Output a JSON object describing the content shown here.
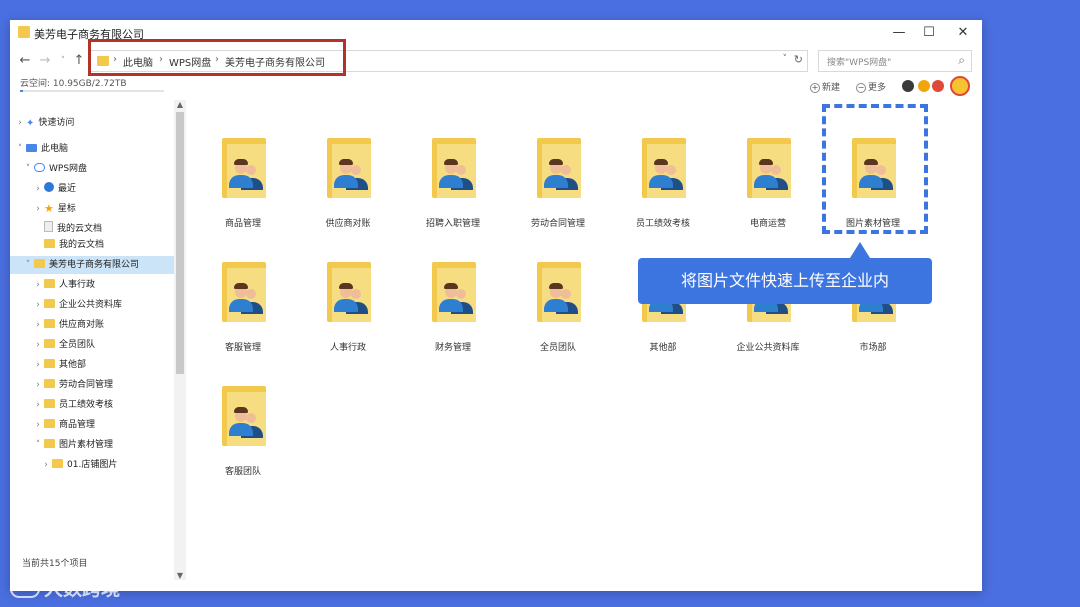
{
  "window": {
    "title": "美芳电子商务有限公司",
    "controls": {
      "minimize": "—",
      "maximize": "☐",
      "close": "✕"
    }
  },
  "nav": {
    "back": "←",
    "forward": "→",
    "dropdown": "˅",
    "up": "↑"
  },
  "address": {
    "leading_sep": "›",
    "crumbs": [
      "此电脑",
      "WPS网盘",
      "美芳电子商务有限公司"
    ],
    "sep": "›",
    "dropdown": "˅",
    "refresh": "↻"
  },
  "search": {
    "placeholder": "搜索\"WPS网盘\"",
    "icon": "⌕"
  },
  "storage": {
    "text": "云空间: 10.95GB/2.72TB",
    "used_fraction": 0.004
  },
  "toolbar": {
    "new_label": "新建",
    "more_label": "更多",
    "badge_colors": [
      "#3a3a3a",
      "#f2a60c",
      "#e0483a"
    ]
  },
  "sidebar": {
    "items": [
      {
        "label": "快速访问",
        "chev": "›",
        "icon": "pin"
      },
      {
        "label": "此电脑",
        "chev": "˅",
        "icon": "pc"
      },
      {
        "label": "WPS网盘",
        "chev": "˅",
        "icon": "cloud"
      },
      {
        "label": "最近",
        "chev": "›",
        "icon": "clock"
      },
      {
        "label": "星标",
        "chev": "›",
        "icon": "star"
      },
      {
        "label": "我的云文档",
        "chev": "",
        "icon": "doc"
      },
      {
        "label": "我的云文档",
        "chev": "",
        "icon": "folder"
      },
      {
        "label": "美芳电子商务有限公司",
        "chev": "˅",
        "icon": "folder"
      },
      {
        "label": "人事行政",
        "chev": "›",
        "icon": "folder"
      },
      {
        "label": "企业公共资料库",
        "chev": "›",
        "icon": "folder"
      },
      {
        "label": "供应商对账",
        "chev": "›",
        "icon": "folder"
      },
      {
        "label": "全员团队",
        "chev": "›",
        "icon": "folder"
      },
      {
        "label": "其他部",
        "chev": "›",
        "icon": "folder"
      },
      {
        "label": "劳动合同管理",
        "chev": "›",
        "icon": "folder"
      },
      {
        "label": "员工绩效考核",
        "chev": "›",
        "icon": "folder"
      },
      {
        "label": "商品管理",
        "chev": "›",
        "icon": "folder"
      },
      {
        "label": "图片素材管理",
        "chev": "˅",
        "icon": "folder"
      },
      {
        "label": "01.店铺图片",
        "chev": "›",
        "icon": "folder"
      }
    ],
    "status": "当前共15个项目",
    "scroll_up": "▲",
    "scroll_down": "▼"
  },
  "folders": [
    "商品管理",
    "供应商对账",
    "招聘入职管理",
    "劳动合同管理",
    "员工绩效考核",
    "电商运营",
    "图片素材管理",
    "客服管理",
    "人事行政",
    "财务管理",
    "全员团队",
    "其他部",
    "企业公共资料库",
    "市场部",
    "客服团队"
  ],
  "callout": {
    "text": "将图片文件快速上传至企业内"
  },
  "watermark": {
    "text": "大数跨境"
  }
}
